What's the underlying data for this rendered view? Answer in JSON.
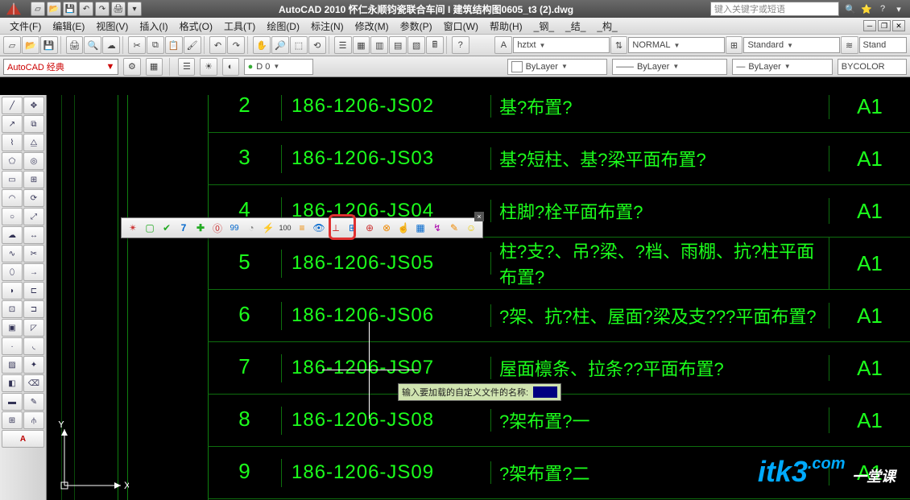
{
  "app": {
    "title": "AutoCAD 2010  怀仁永顺钧瓷联合车间 I 建筑结构图0605_t3 (2).dwg",
    "search_placeholder": "键入关键字或短语"
  },
  "menus": [
    "文件(F)",
    "编辑(E)",
    "视图(V)",
    "插入(I)",
    "格式(O)",
    "工具(T)",
    "绘图(D)",
    "标注(N)",
    "修改(M)",
    "参数(P)",
    "窗口(W)",
    "帮助(H)",
    "_钢_",
    "_结_",
    "_构_"
  ],
  "workspace": "AutoCAD 经典",
  "layer": {
    "dim": "D 0"
  },
  "style_combos": {
    "textstyle": "hztxt",
    "dimstyle": "NORMAL",
    "tablestyle": "Standard",
    "mlstyle": "Stand"
  },
  "props": {
    "color": "ByLayer",
    "linetype": "ByLayer",
    "lineweight": "ByLayer",
    "plotstyle": "BYCOLOR"
  },
  "rows": [
    {
      "n": "2",
      "code": "186-1206-JS02",
      "desc": "基?布置?",
      "fmt": "A1"
    },
    {
      "n": "3",
      "code": "186-1206-JS03",
      "desc": "基?短柱、基?梁平面布置?",
      "fmt": "A1"
    },
    {
      "n": "4",
      "code": "186-1206-JS04",
      "desc": "柱脚?栓平面布置?",
      "fmt": "A1"
    },
    {
      "n": "5",
      "code": "186-1206-JS05",
      "desc": "柱?支?、吊?梁、?档、雨棚、抗?柱平面布置?",
      "fmt": "A1"
    },
    {
      "n": "6",
      "code": "186-1206-JS06",
      "desc": "?架、抗?柱、屋面?梁及支???平面布置?",
      "fmt": "A1"
    },
    {
      "n": "7",
      "code": "186-1206-JS07",
      "desc": "屋面檩条、拉条??平面布置?",
      "fmt": "A1"
    },
    {
      "n": "8",
      "code": "186-1206-JS08",
      "desc": "?架布置?一",
      "fmt": "A1"
    },
    {
      "n": "9",
      "code": "186-1206-JS09",
      "desc": "?架布置?二",
      "fmt": "A1"
    }
  ],
  "prompt": "输入要加载的自定义文件的名称:",
  "ucs": {
    "x": "X",
    "y": "Y"
  },
  "watermark": {
    "brand": "itk3",
    "domain": ".com",
    "tag": "一堂课"
  },
  "qat_icons": [
    "new",
    "open",
    "save",
    "undo",
    "redo",
    "print"
  ],
  "float_icons": [
    "⚙",
    "▢",
    "✔",
    "7",
    "✚",
    "⓪",
    "99",
    "◔",
    "⚡",
    "100",
    "≡",
    "👁",
    "⟂",
    "⊞",
    "⊕",
    "⊗",
    "☝",
    "▦",
    "↯",
    "✎",
    "☺"
  ],
  "colors": {
    "green": "#1cff1c",
    "grid": "#0e6e0e"
  }
}
